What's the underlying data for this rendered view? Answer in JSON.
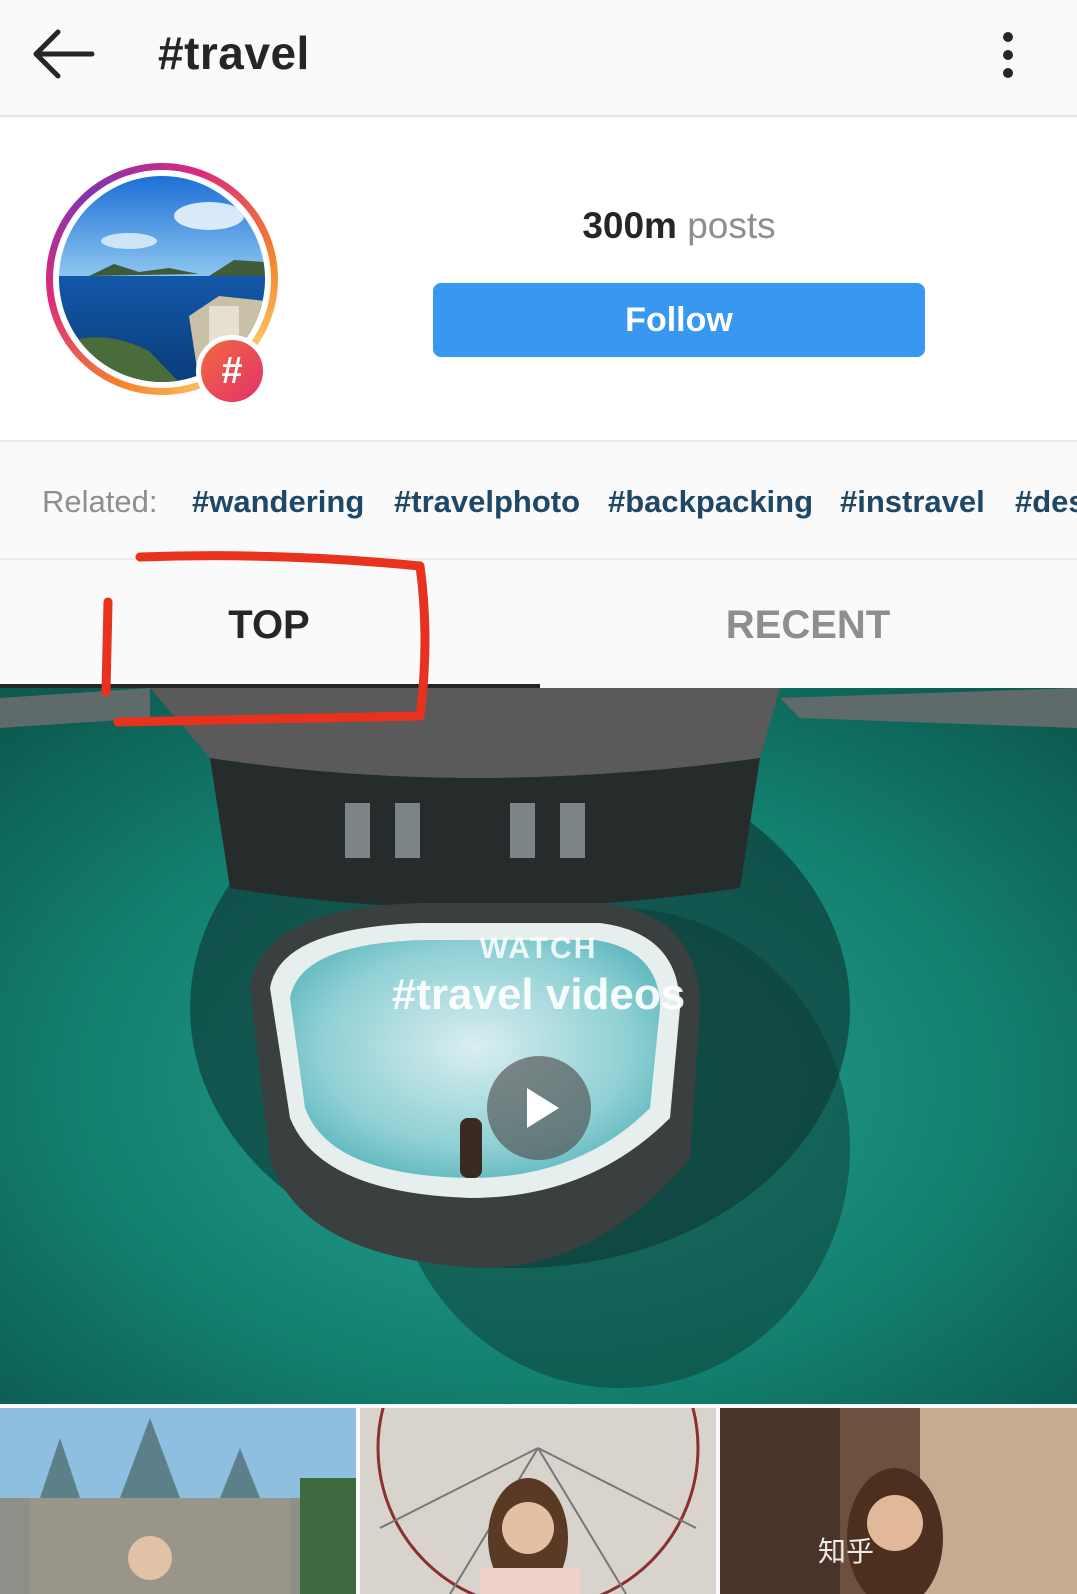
{
  "app_bar": {
    "title": "#travel",
    "back_icon": "arrow-left-icon",
    "more_icon": "more-vertical-icon"
  },
  "header": {
    "posts_count": "300m",
    "posts_label": "posts",
    "follow_label": "Follow",
    "badge_symbol": "#",
    "follow_color": "#3897f0"
  },
  "related": {
    "label": "Related:",
    "tags": [
      "#wandering",
      "#travelphoto",
      "#backpacking",
      "#instravel",
      "#des"
    ]
  },
  "tabs": {
    "top": "TOP",
    "recent": "RECENT",
    "active": "TOP"
  },
  "video_tile": {
    "watch_label": "WATCH",
    "title": "#travel videos",
    "play_icon": "play-icon"
  },
  "watermark": {
    "text": "知乎"
  }
}
